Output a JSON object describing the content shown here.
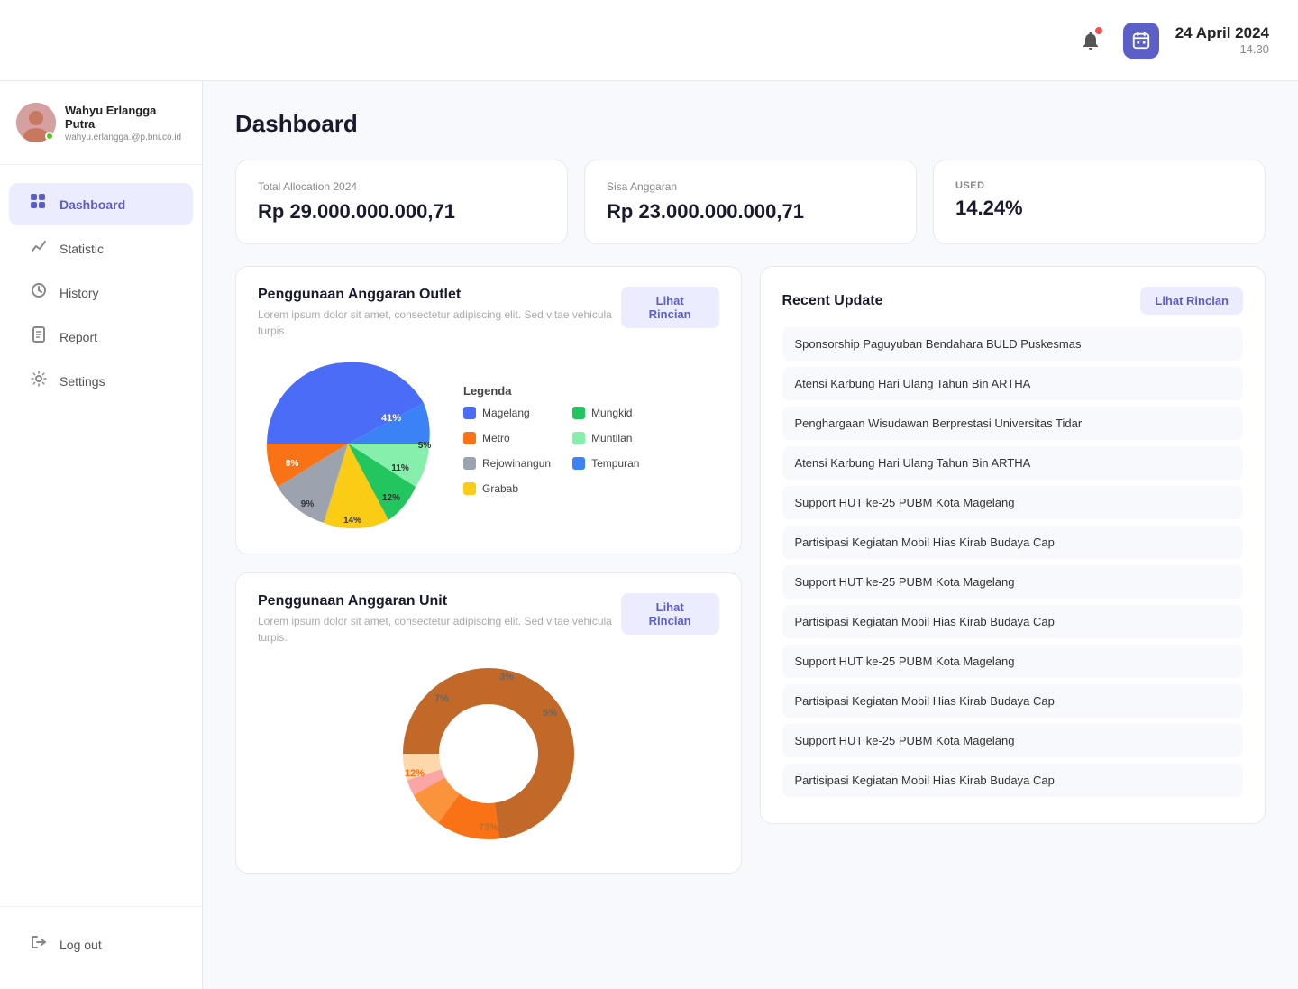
{
  "header": {
    "date": "24 April 2024",
    "time": "14.30"
  },
  "user": {
    "name": "Wahyu Erlangga Putra",
    "email": "wahyu.erlangga.@p.bni.co.id"
  },
  "sidebar": {
    "items": [
      {
        "id": "dashboard",
        "label": "Dashboard",
        "icon": "⊞",
        "active": true
      },
      {
        "id": "statistic",
        "label": "Statistic",
        "icon": "📈",
        "active": false
      },
      {
        "id": "history",
        "label": "History",
        "icon": "🕐",
        "active": false
      },
      {
        "id": "report",
        "label": "Report",
        "icon": "📋",
        "active": false
      },
      {
        "id": "settings",
        "label": "Settings",
        "icon": "⚙",
        "active": false
      }
    ],
    "logout": "Log out"
  },
  "page": {
    "title": "Dashboard"
  },
  "stats": [
    {
      "label": "Total Allocation 2024",
      "value": "Rp 29.000.000.000,71"
    },
    {
      "label": "Sisa Anggaran",
      "value": "Rp 23.000.000.000,71"
    },
    {
      "label": "USED",
      "value": "14.24%"
    }
  ],
  "outlet_card": {
    "title": "Penggunaan Anggaran Outlet",
    "desc": "Lorem ipsum dolor sit amet, consectetur adipiscing elit.\nSed vitae vehicula turpis.",
    "btn": "Lihat Rincian",
    "legend_title": "Legenda",
    "slices": [
      {
        "label": "Magelang",
        "color": "#4a6cf7",
        "pct": 41
      },
      {
        "label": "Metro",
        "color": "#f97316",
        "pct": 8
      },
      {
        "label": "Rejowinangun",
        "color": "#9ca3af",
        "pct": 9
      },
      {
        "label": "Grabab",
        "color": "#facc15",
        "pct": 14
      },
      {
        "label": "Mungkid",
        "color": "#22c55e",
        "pct": 12
      },
      {
        "label": "Muntilan",
        "color": "#86efac",
        "pct": 11
      },
      {
        "label": "Tempuran",
        "color": "#3b82f6",
        "pct": 5
      }
    ]
  },
  "unit_card": {
    "title": "Penggunaan Anggaran Unit",
    "desc": "Lorem ipsum dolor sit amet, consectetur adipiscing elit.\nSed vitae vehicula turpis.",
    "btn": "Lihat Rincian",
    "slices": [
      {
        "label": "73%",
        "color": "#c2692a",
        "pct": 73
      },
      {
        "label": "12%",
        "color": "#f97316",
        "pct": 12
      },
      {
        "label": "7%",
        "color": "#fb923c",
        "pct": 7
      },
      {
        "label": "3%",
        "color": "#fca5a5",
        "pct": 3
      },
      {
        "label": "5%",
        "color": "#fed7aa",
        "pct": 5
      }
    ]
  },
  "recent": {
    "title": "Recent Update",
    "btn": "Lihat Rincian",
    "items": [
      "Sponsorship Paguyuban Bendahara BULD Puskesmas",
      "Atensi Karbung Hari Ulang Tahun Bin ARTHA",
      "Penghargaan Wisudawan Berprestasi Universitas Tidar",
      "Atensi Karbung Hari Ulang Tahun Bin ARTHA",
      "Support HUT ke-25 PUBM Kota Magelang",
      "Partisipasi Kegiatan Mobil Hias Kirab Budaya Cap",
      "Support HUT ke-25 PUBM Kota Magelang",
      "Partisipasi Kegiatan Mobil Hias Kirab Budaya Cap",
      "Support HUT ke-25 PUBM Kota Magelang",
      "Partisipasi Kegiatan Mobil Hias Kirab Budaya Cap",
      "Support HUT ke-25 PUBM Kota Magelang",
      "Partisipasi Kegiatan Mobil Hias Kirab Budaya Cap"
    ]
  }
}
